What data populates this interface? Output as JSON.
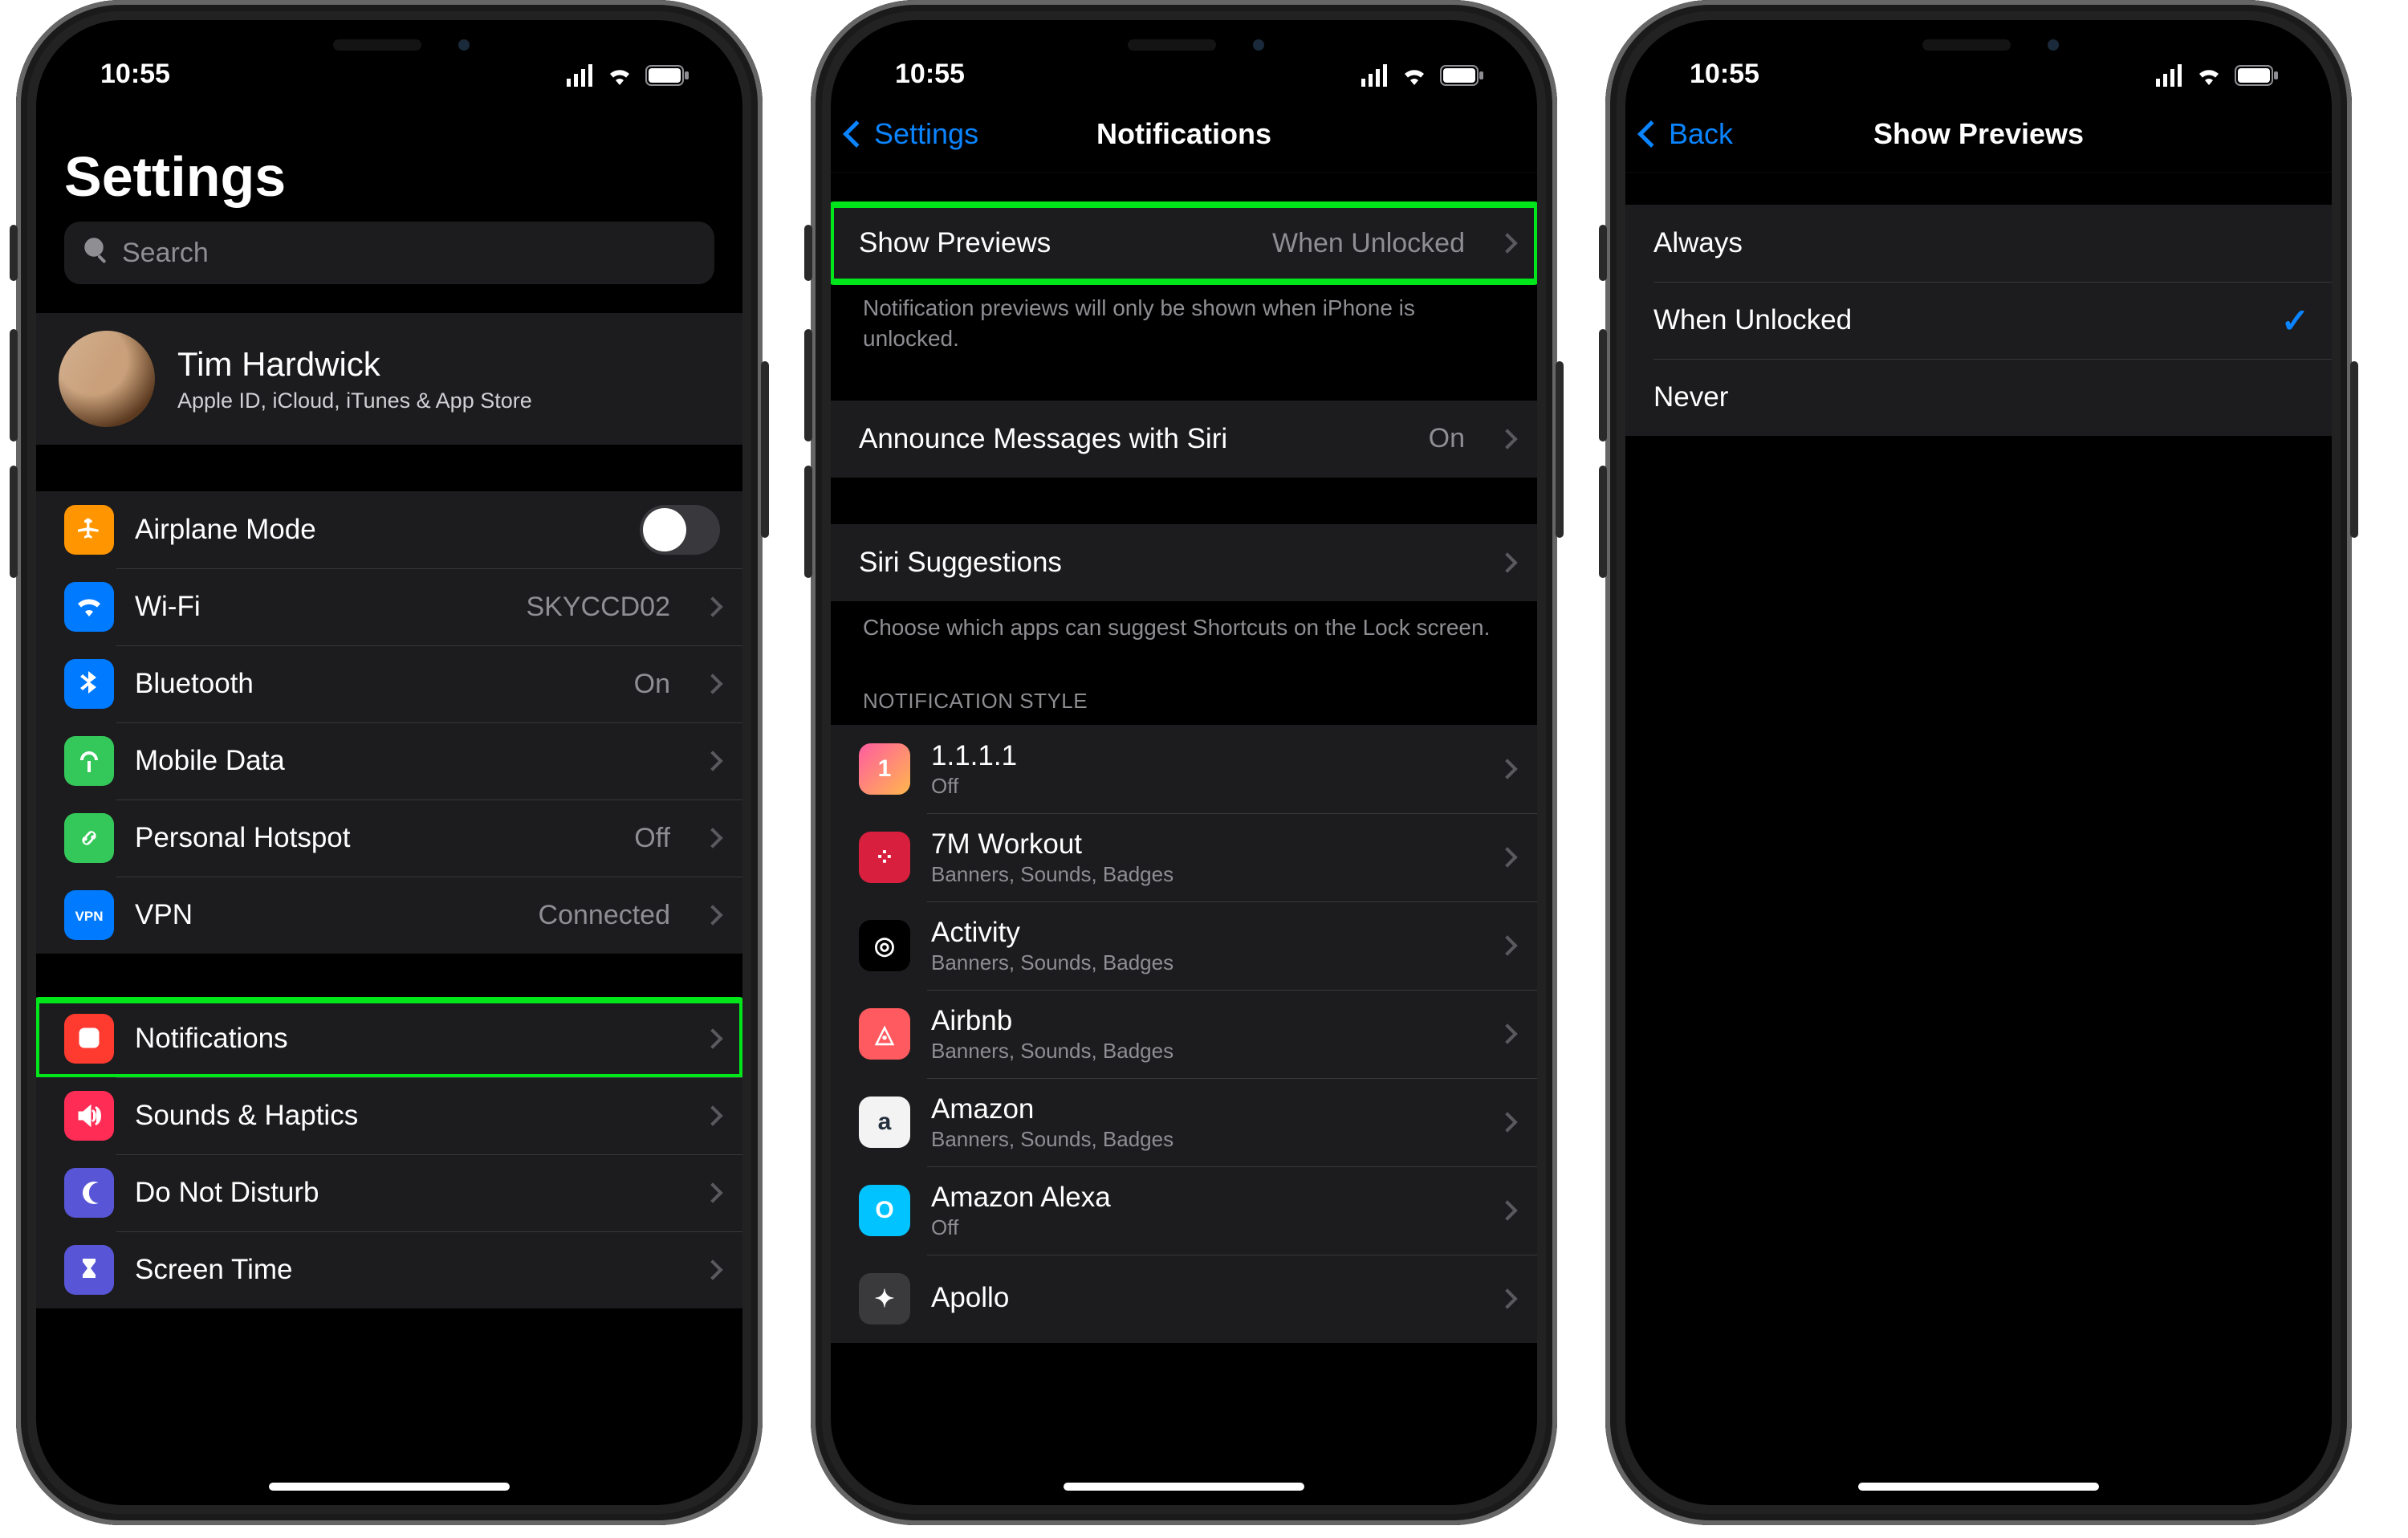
{
  "status": {
    "time": "10:55"
  },
  "phone1": {
    "title": "Settings",
    "search_placeholder": "Search",
    "profile": {
      "name": "Tim Hardwick",
      "sub": "Apple ID, iCloud, iTunes & App Store"
    },
    "net": [
      {
        "label": "Airplane Mode",
        "kind": "toggle",
        "color": "#ff9500",
        "icon": "airplane"
      },
      {
        "label": "Wi-Fi",
        "detail": "SKYCCD02",
        "color": "#007aff",
        "icon": "wifi"
      },
      {
        "label": "Bluetooth",
        "detail": "On",
        "color": "#007aff",
        "icon": "bluetooth"
      },
      {
        "label": "Mobile Data",
        "color": "#34c759",
        "icon": "antenna"
      },
      {
        "label": "Personal Hotspot",
        "detail": "Off",
        "color": "#34c759",
        "icon": "link"
      },
      {
        "label": "VPN",
        "detail": "Connected",
        "color": "#007aff",
        "icon": "vpn"
      }
    ],
    "sys": [
      {
        "label": "Notifications",
        "color": "#ff3b30",
        "icon": "bell",
        "highlight": true
      },
      {
        "label": "Sounds & Haptics",
        "color": "#ff2d55",
        "icon": "speaker"
      },
      {
        "label": "Do Not Disturb",
        "color": "#5856d6",
        "icon": "moon"
      },
      {
        "label": "Screen Time",
        "color": "#5856d6",
        "icon": "hourglass"
      }
    ]
  },
  "phone2": {
    "back": "Settings",
    "title": "Notifications",
    "previews": {
      "label": "Show Previews",
      "value": "When Unlocked",
      "foot": "Notification previews will only be shown when iPhone is unlocked."
    },
    "announce": {
      "label": "Announce Messages with Siri",
      "value": "On"
    },
    "siri": {
      "label": "Siri Suggestions",
      "foot": "Choose which apps can suggest Shortcuts on the Lock screen."
    },
    "style_head": "Notification Style",
    "apps": [
      {
        "name": "1.1.1.1",
        "sub": "Off",
        "bg": "linear-gradient(135deg,#ff5ca0,#ffb74d)",
        "glyph": "1"
      },
      {
        "name": "7M Workout",
        "sub": "Banners, Sounds, Badges",
        "bg": "#d81f3e",
        "glyph": "⁘"
      },
      {
        "name": "Activity",
        "sub": "Banners, Sounds, Badges",
        "bg": "#000",
        "glyph": "◎"
      },
      {
        "name": "Airbnb",
        "sub": "Banners, Sounds, Badges",
        "bg": "#ff5a5f",
        "glyph": "◬"
      },
      {
        "name": "Amazon",
        "sub": "Banners, Sounds, Badges",
        "bg": "#f3f3f3",
        "glyph": "a",
        "fg": "#232f3e"
      },
      {
        "name": "Amazon Alexa",
        "sub": "Off",
        "bg": "#00c3ff",
        "glyph": "O"
      },
      {
        "name": "Apollo",
        "sub": "",
        "bg": "#3a3a3c",
        "glyph": "✦"
      }
    ]
  },
  "phone3": {
    "back": "Back",
    "title": "Show Previews",
    "options": [
      {
        "label": "Always",
        "selected": false
      },
      {
        "label": "When Unlocked",
        "selected": true
      },
      {
        "label": "Never",
        "selected": false
      }
    ]
  }
}
